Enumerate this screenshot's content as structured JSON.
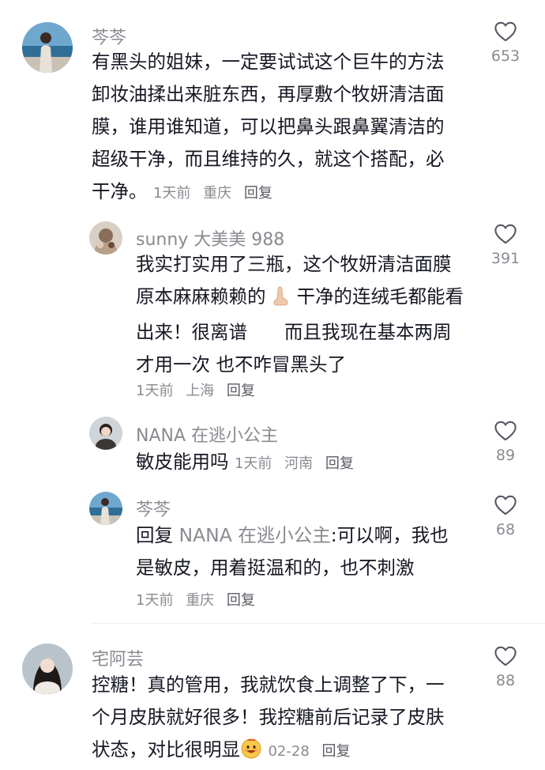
{
  "comments": [
    {
      "user": "芩芩",
      "text_line1": "有黑头的姐妹，一定要试试这个巨牛的方法",
      "text_line2": "卸妆油揉出来脏东西，再厚敷个牧妍清洁面",
      "text_line3": "膜，谁用谁知道，可以把鼻头跟鼻翼清洁的",
      "text_line4": "超级干净，而且维持的久，就这个搭配，必",
      "text_line5": "干净。",
      "time": "1天前",
      "location": "重庆",
      "reply_label": "回复",
      "likes": "653"
    },
    {
      "user": "sunny 大美美 988",
      "text_line1": "我实打实用了三瓶，这个牧妍清洁面膜",
      "text_line2a": "原本麻麻赖赖的",
      "text_line2b": "干净的连绒毛都能看",
      "text_line3": "出来！很离谱　　而且我现在基本两周",
      "text_line4": "才用一次 也不咋冒黑头了",
      "time": "1天前",
      "location": "上海",
      "reply_label": "回复",
      "likes": "391"
    },
    {
      "user": "NANA 在逃小公主",
      "text": "敏皮能用吗",
      "time": "1天前",
      "location": "河南",
      "reply_label": "回复",
      "likes": "89"
    },
    {
      "user": "芩芩",
      "reply_prefix": "回复",
      "reply_to": "NANA 在逃小公主",
      "text_line1": ":可以啊，我也",
      "text_line2": "是敏皮，用着挺温和的，也不刺激",
      "time": "1天前",
      "location": "重庆",
      "reply_label": "回复",
      "likes": "68"
    },
    {
      "user": "宅阿芸",
      "text_line1": "控糖！真的管用，我就饮食上调整了下，一",
      "text_line2": "个月皮肤就好很多！我控糖前后记录了皮肤",
      "text_line3": "状态，对比很明显",
      "time": "02-28",
      "reply_label": "回复",
      "likes": "88"
    }
  ],
  "icons": {
    "like": "heart-outline-icon",
    "nose_emoji": "nose-emoji-icon",
    "face_emoji": "happy-face-emoji-icon"
  },
  "colors": {
    "text": "#161823",
    "muted": "#8a8b91",
    "divider": "#efeff1"
  }
}
